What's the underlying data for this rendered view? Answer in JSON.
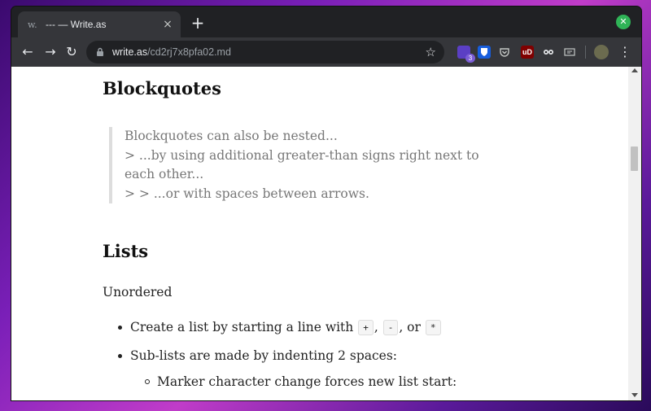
{
  "browser": {
    "tab": {
      "favicon": "w.",
      "title": "--- — Write.as",
      "close_icon": "×"
    },
    "new_tab_label": "+",
    "toolbar": {
      "back_icon": "←",
      "forward_icon": "→",
      "reload_icon": "↻",
      "lock_icon": "lock-icon",
      "url_host": "write.as",
      "url_path": "/cd2rj7x8pfa02.md",
      "star_icon": "☆",
      "extensions": [
        {
          "name": "tab-manager-extension",
          "badge": "3",
          "color": "#5b3fc4"
        },
        {
          "name": "bitwarden-extension",
          "color": "#175ddc"
        },
        {
          "name": "pocket-extension",
          "color": "#35363a"
        },
        {
          "name": "ublock-extension",
          "label": "uD",
          "color": "#800000"
        },
        {
          "name": "privacy-extension",
          "color": "#35363a"
        },
        {
          "name": "dev-extension",
          "color": "#35363a"
        },
        {
          "name": "profile-avatar",
          "color": "#6b6b4f"
        }
      ],
      "menu_icon": "⋮"
    },
    "green_extension_icon": "✕",
    "accent_green": "#2fb457"
  },
  "article": {
    "blockquotes_heading": "Blockquotes",
    "blockquote_lines": [
      "Blockquotes can also be nested...",
      "> ...by using additional greater-than signs right next to each other...",
      "> > ...or with spaces between arrows."
    ],
    "lists_heading": "Lists",
    "unordered_label": "Unordered",
    "list_items": {
      "item1_prefix": "Create a list by starting a line with",
      "code_plus": "+",
      "comma": ",",
      "code_minus": "-",
      "or_text": ", or",
      "code_star": "*",
      "item2": "Sub-lists are made by indenting 2 spaces:",
      "sub_item1": "Marker character change forces new list start:"
    }
  }
}
